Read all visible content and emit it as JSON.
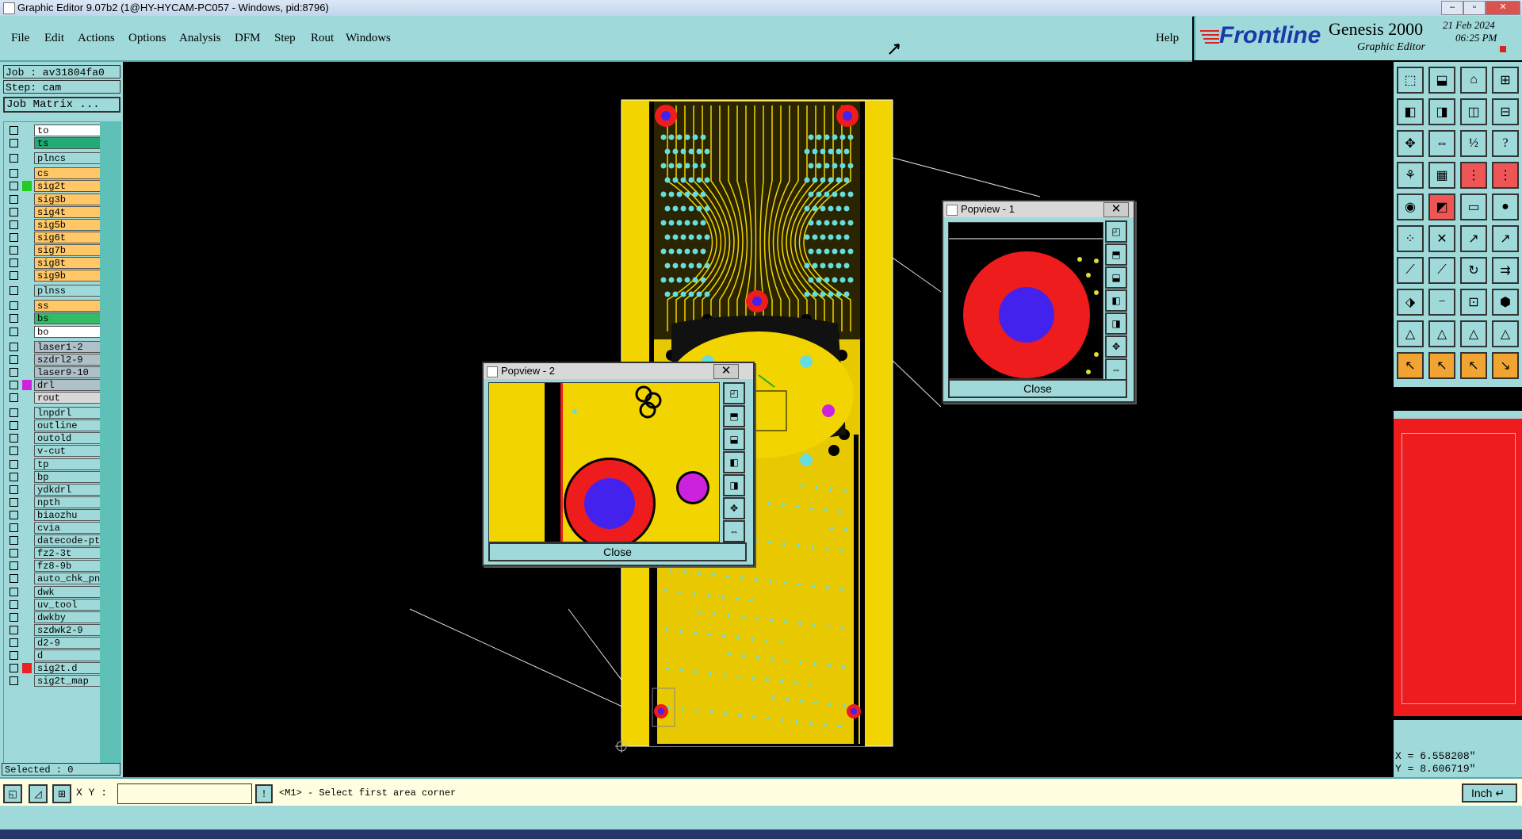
{
  "window": {
    "title": "Graphic Editor 9.07b2 (1@HY-HYCAM-PC057 - Windows, pid:8796)",
    "buttons": [
      "–",
      "▫",
      "✕"
    ]
  },
  "menu": {
    "items": [
      "File",
      "Edit",
      "Actions",
      "Options",
      "Analysis",
      "DFM",
      "Step",
      "Rout",
      "Windows"
    ],
    "help": "Help"
  },
  "brand": {
    "company": "Frontline",
    "product": "Genesis 2000",
    "subtitle": "Graphic Editor",
    "date": "21 Feb 2024",
    "time": "06:25 PM"
  },
  "job": {
    "job_label": "Job : av31804fa0",
    "step_label": "Step: cam",
    "matrix_button": "Job Matrix ..."
  },
  "layers": [
    {
      "name": "to",
      "color": "white",
      "swatch": ""
    },
    {
      "name": "ts",
      "color": "teal",
      "swatch": ""
    },
    {
      "name": "plncs",
      "color": "cyan",
      "swatch": ""
    },
    {
      "name": "cs",
      "color": "orange",
      "swatch": ""
    },
    {
      "name": "sig2t",
      "color": "orange",
      "swatch": "#22cc22"
    },
    {
      "name": "sig3b",
      "color": "orange",
      "swatch": ""
    },
    {
      "name": "sig4t",
      "color": "orange",
      "swatch": ""
    },
    {
      "name": "sig5b",
      "color": "orange",
      "swatch": ""
    },
    {
      "name": "sig6t",
      "color": "orange",
      "swatch": ""
    },
    {
      "name": "sig7b",
      "color": "orange",
      "swatch": ""
    },
    {
      "name": "sig8t",
      "color": "orange",
      "swatch": ""
    },
    {
      "name": "sig9b",
      "color": "orange",
      "swatch": ""
    },
    {
      "name": "plnss",
      "color": "cyan",
      "swatch": ""
    },
    {
      "name": "ss",
      "color": "orange",
      "swatch": ""
    },
    {
      "name": "bs",
      "color": "green2",
      "swatch": ""
    },
    {
      "name": "bo",
      "color": "white",
      "swatch": ""
    },
    {
      "name": "laser1-2",
      "color": "grey",
      "swatch": ""
    },
    {
      "name": "szdrl2-9",
      "color": "grey",
      "swatch": ""
    },
    {
      "name": "laser9-10",
      "color": "grey",
      "swatch": ""
    },
    {
      "name": "drl",
      "color": "grey",
      "swatch": "#cc22dd"
    },
    {
      "name": "rout",
      "color": "lightgrey",
      "swatch": ""
    },
    {
      "name": "lnpdrl",
      "color": "cyan",
      "swatch": ""
    },
    {
      "name": "outline",
      "color": "cyan",
      "swatch": ""
    },
    {
      "name": "outold",
      "color": "cyan",
      "swatch": ""
    },
    {
      "name": "v-cut",
      "color": "cyan",
      "swatch": ""
    },
    {
      "name": "tp",
      "color": "cyan",
      "swatch": ""
    },
    {
      "name": "bp",
      "color": "cyan",
      "swatch": ""
    },
    {
      "name": "ydkdrl",
      "color": "cyan",
      "swatch": ""
    },
    {
      "name": "npth",
      "color": "cyan",
      "swatch": ""
    },
    {
      "name": "biaozhu",
      "color": "cyan",
      "swatch": ""
    },
    {
      "name": "cvia",
      "color": "cyan",
      "swatch": ""
    },
    {
      "name": "datecode-pt",
      "color": "cyan",
      "swatch": ""
    },
    {
      "name": "fz2-3t",
      "color": "cyan",
      "swatch": ""
    },
    {
      "name": "fz8-9b",
      "color": "cyan",
      "swatch": ""
    },
    {
      "name": "auto_chk_pn",
      "color": "cyan",
      "swatch": ""
    },
    {
      "name": "dwk",
      "color": "cyan",
      "swatch": ""
    },
    {
      "name": "uv_tool",
      "color": "cyan",
      "swatch": ""
    },
    {
      "name": "dwkby",
      "color": "cyan",
      "swatch": ""
    },
    {
      "name": "szdwk2-9",
      "color": "cyan",
      "swatch": ""
    },
    {
      "name": "d2-9",
      "color": "cyan",
      "swatch": ""
    },
    {
      "name": "d",
      "color": "cyan",
      "swatch": ""
    },
    {
      "name": "sig2t.d",
      "color": "cyan",
      "swatch": "#ee2222"
    },
    {
      "name": "sig2t_map",
      "color": "cyan",
      "swatch": ""
    }
  ],
  "status": {
    "selected": "Selected : 0",
    "xy_label": "X Y :",
    "xy_value": "",
    "message": "<M1> - Select first area corner",
    "units": "Inch",
    "coord_x": "X = 6.558208\"",
    "coord_y": "Y = 8.606719\""
  },
  "popview1": {
    "title": "Popview - 1",
    "close": "Close"
  },
  "popview2": {
    "title": "Popview - 2",
    "close": "Close"
  },
  "colors": {
    "panel": "#9fd9d9",
    "board": "#f2d400",
    "pad_red": "#ee1c1c",
    "pad_blue": "#4422ee",
    "pad_cyan": "#66dddd",
    "magenta": "#cc22dd"
  }
}
